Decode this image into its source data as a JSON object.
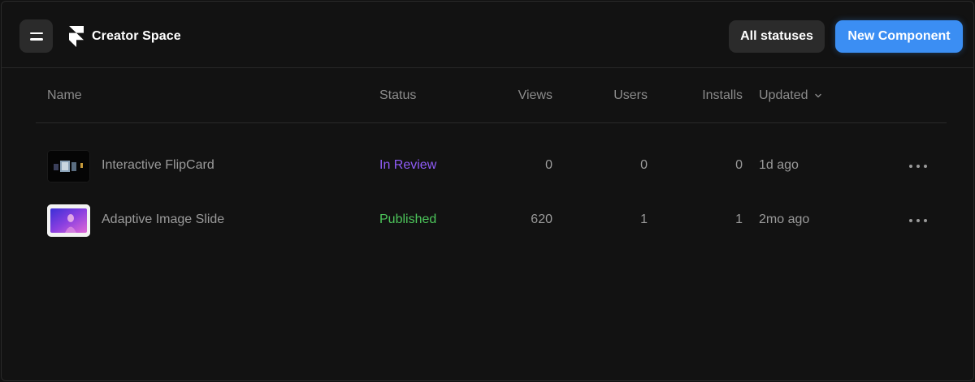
{
  "header": {
    "app_name": "Creator Space",
    "filter_label": "All statuses",
    "new_button_label": "New Component"
  },
  "table": {
    "columns": {
      "name": "Name",
      "status": "Status",
      "views": "Views",
      "users": "Users",
      "installs": "Installs",
      "updated": "Updated"
    },
    "rows": [
      {
        "name": "Interactive FlipCard",
        "status": "In Review",
        "status_color": "#8f5cf7",
        "views": "0",
        "users": "0",
        "installs": "0",
        "updated": "1d ago"
      },
      {
        "name": "Adaptive Image Slide",
        "status": "Published",
        "status_color": "#4cc45a",
        "views": "620",
        "users": "1",
        "installs": "1",
        "updated": "2mo ago"
      }
    ]
  },
  "colors": {
    "background": "#121212",
    "accent": "#3b8ef3",
    "review": "#8f5cf7",
    "published": "#4cc45a"
  },
  "icons": {
    "menu": "menu-icon",
    "logo": "framer-logo",
    "sort": "chevron-down-icon",
    "more": "more-horizontal-icon"
  }
}
